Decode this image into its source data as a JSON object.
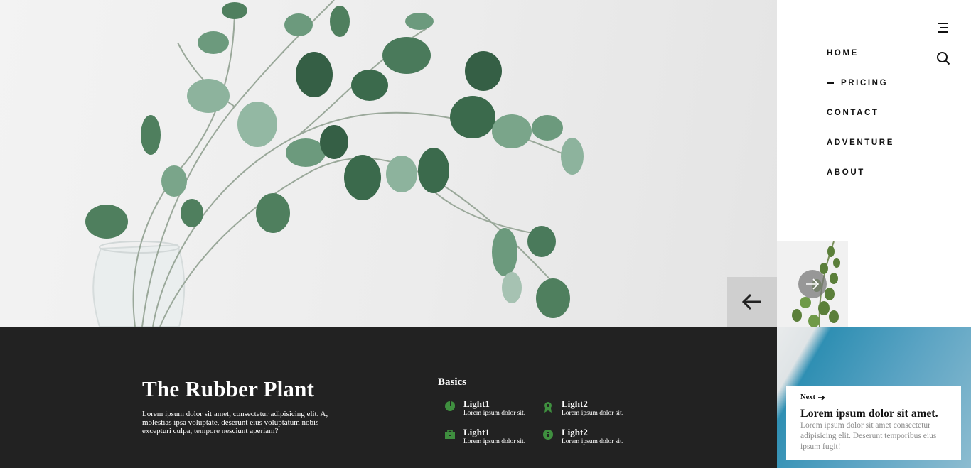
{
  "nav": {
    "items": [
      {
        "label": "HOME",
        "active": false
      },
      {
        "label": "PRICING",
        "active": true
      },
      {
        "label": "CONTACT",
        "active": false
      },
      {
        "label": "ADVENTURE",
        "active": false
      },
      {
        "label": "ABOUT",
        "active": false
      }
    ],
    "menu_icon": "menu-icon",
    "search_icon": "search-icon"
  },
  "slider": {
    "prev_icon": "arrow-left-icon",
    "next_icon": "arrow-right-icon"
  },
  "plant": {
    "title": "The Rubber Plant",
    "description": "Lorem ipsum dolor sit amet, consectetur adipisicing elit. A, molestias ipsa voluptate, deserunt eius voluptatum nobis excepturi culpa, tempore nesciunt aperiam?"
  },
  "basics": {
    "title": "Basics",
    "items": [
      {
        "title": "Light1",
        "text": "Lorem ipsum dolor sit.",
        "icon": "pie-chart-icon"
      },
      {
        "title": "Light2",
        "text": "Lorem ipsum dolor sit.",
        "icon": "award-icon"
      },
      {
        "title": "Light1",
        "text": "Lorem ipsum dolor sit.",
        "icon": "briefcase-icon"
      },
      {
        "title": "Light2",
        "text": "Lorem ipsum dolor sit.",
        "icon": "info-icon"
      }
    ]
  },
  "next_card": {
    "label": "Next",
    "title": "Lorem ipsum dolor sit amet.",
    "text": "Lorem ipsum dolor sit amet consectetur adipisicing elit. Deserunt temporibus eius ipsum fugit!"
  },
  "colors": {
    "dark_band": "#222222",
    "accent_green": "#3f8f3f",
    "nav_text": "#111111"
  }
}
